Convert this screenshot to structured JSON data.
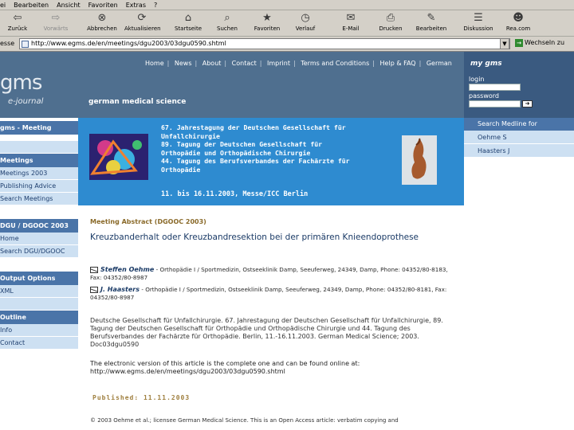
{
  "browser": {
    "menu": [
      "ei",
      "Bearbeiten",
      "Ansicht",
      "Favoriten",
      "Extras",
      "?"
    ],
    "toolbar": [
      {
        "label": "Zurück",
        "icon": "back-icon"
      },
      {
        "label": "Vorwärts",
        "icon": "forward-icon"
      },
      {
        "label": "Abbrechen",
        "icon": "stop-icon"
      },
      {
        "label": "Aktualisieren",
        "icon": "refresh-icon"
      },
      {
        "label": "Startseite",
        "icon": "home-icon"
      },
      {
        "label": "Suchen",
        "icon": "search-icon"
      },
      {
        "label": "Favoriten",
        "icon": "favorites-icon"
      },
      {
        "label": "Verlauf",
        "icon": "history-icon"
      },
      {
        "label": "E-Mail",
        "icon": "mail-icon"
      },
      {
        "label": "Drucken",
        "icon": "print-icon"
      },
      {
        "label": "Bearbeiten",
        "icon": "edit-icon"
      },
      {
        "label": "Diskussion",
        "icon": "discuss-icon"
      },
      {
        "label": "Rea.com",
        "icon": "messenger-icon"
      }
    ],
    "address_label": "esse",
    "address_url": "http://www.egms.de/en/meetings/dgu2003/03dgu0590.shtml",
    "go_label": "Wechseln zu"
  },
  "header": {
    "logo": "gms",
    "logo_sub": "e-journal",
    "site_title": "german medical science",
    "nav": [
      "Home",
      "News",
      "About",
      "Contact",
      "Imprint",
      "Terms and Conditions",
      "Help & FAQ",
      "German"
    ],
    "mygms": "my gms",
    "login_label": "login",
    "password_label": "password"
  },
  "sidebar": {
    "sections": [
      {
        "title": "gms - Meeting",
        "items": []
      },
      {
        "title": "Meetings",
        "items": [
          "Meetings 2003",
          "Publishing Advice",
          "Search Meetings"
        ]
      },
      {
        "title": "DGU / DGOOC 2003",
        "items": [
          "Home",
          "Search DGU/DGOOC"
        ]
      },
      {
        "title": "Output Options",
        "items": [
          "XML"
        ]
      },
      {
        "title": "Outline",
        "items": [
          "Info",
          "Contact"
        ]
      }
    ]
  },
  "banner": {
    "lines": [
      "67. Jahrestagung der Deutschen Gesellschaft für",
      "Unfallchirurgie",
      "89. Tagung der Deutschen Gesellschaft für",
      "Orthopädie und Orthopädische Chirurgie",
      "44. Tagung des Berufsverbandes der Fachärzte für",
      "Orthopädie"
    ],
    "date": "11. bis 16.11.2003, Messe/ICC Berlin"
  },
  "right_sidebar": {
    "head": "Search Medline for",
    "items": [
      "Oehme S",
      "Haasters J"
    ]
  },
  "article": {
    "meeting_label": "Meeting Abstract (DGOOC 2003)",
    "title": "Kreuzbanderhalt oder Kreuzbandresektion bei der primären Knieendoprothese",
    "authors": [
      {
        "name": "Steffen Oehme",
        "affiliation": "- Orthopädie I / Sportmedizin, Ostseeklinik Damp, Seeuferweg, 24349, Damp, Phone: 04352/80-8183, Fax: 04352/80-8987"
      },
      {
        "name": "J. Haasters",
        "affiliation": "- Orthopädie I / Sportmedizin, Ostseeklinik Damp, Seeuferweg, 24349, Damp, Phone: 04352/80-8181, Fax: 04352/80-8987"
      }
    ],
    "citation": "Deutsche Gesellschaft für Unfallchirurgie. 67. Jahrestagung der Deutschen Gesellschaft für Unfallchirurgie, 89. Tagung der Deutschen Gesellschaft für Orthopädie und Orthopädische Chirurgie und 44. Tagung des Berufsverbandes der Fachärzte für Orthopädie. Berlin, 11.-16.11.2003. German Medical Science; 2003. Doc03dgu0590",
    "electronic_text": "The electronic version of this article is the complete one and can be found online at:",
    "electronic_url": "http://www.egms.de/en/meetings/dgu2003/03dgu0590.shtml",
    "published": "Published: 11.11.2003",
    "copyright": "© 2003 Oehme et al.; licensee German Medical Science. This is an Open Access article: verbatim copying and"
  },
  "colors": {
    "header_bg": "#4f6f8f",
    "banner_bg": "#2e8bd0",
    "nav_head": "#4a74a8",
    "nav_item": "#cde0f2",
    "title_blue": "#1a3a66",
    "gold": "#a08040"
  }
}
